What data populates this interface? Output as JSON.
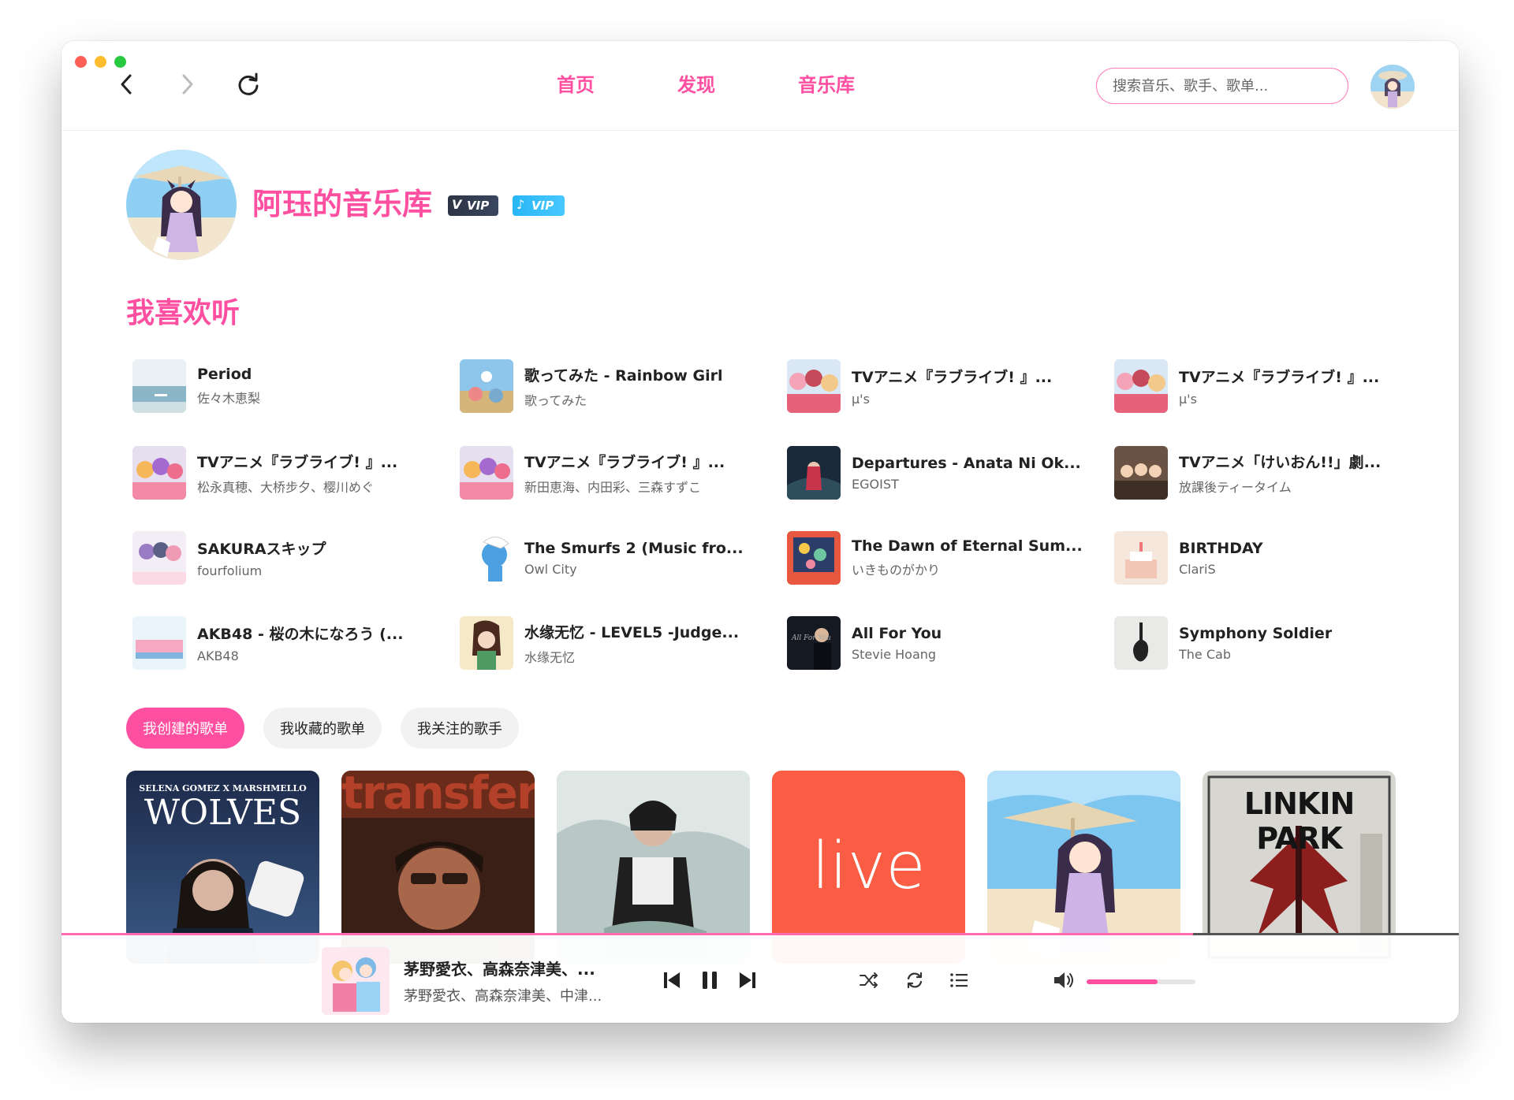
{
  "nav": {
    "links": [
      "首页",
      "发现",
      "音乐库"
    ],
    "search_placeholder": "搜索音乐、歌手、歌单..."
  },
  "profile": {
    "title": "阿珏的音乐库",
    "badges": [
      "VIP",
      "VIP"
    ]
  },
  "liked": {
    "title": "我喜欢听",
    "songs": [
      {
        "title": "Period",
        "artist": "佐々木恵梨"
      },
      {
        "title": "歌ってみた - Rainbow Girl",
        "artist": "歌ってみた"
      },
      {
        "title": "TVアニメ『ラブライブ! 』...",
        "artist": "μ's"
      },
      {
        "title": "TVアニメ『ラブライブ! 』...",
        "artist": "μ's"
      },
      {
        "title": "TVアニメ『ラブライブ! 』...",
        "artist": "松永真穂、大桥步夕、樱川めぐ"
      },
      {
        "title": "TVアニメ『ラブライブ! 』...",
        "artist": "新田恵海、内田彩、三森すずこ"
      },
      {
        "title": "Departures - Anata Ni Ok...",
        "artist": "EGOIST"
      },
      {
        "title": "TVアニメ「けいおん!!」劇...",
        "artist": "放課後ティータイム"
      },
      {
        "title": "SAKURAスキップ",
        "artist": "fourfolium"
      },
      {
        "title": "The Smurfs 2 (Music fro...",
        "artist": "Owl City"
      },
      {
        "title": "The Dawn of Eternal Sum...",
        "artist": "いきものがかり"
      },
      {
        "title": "BIRTHDAY",
        "artist": "ClariS"
      },
      {
        "title": "AKB48 - 桜の木になろう (...",
        "artist": "AKB48"
      },
      {
        "title": "水缘无忆 - LEVEL5 -Judge...",
        "artist": "水缘无忆"
      },
      {
        "title": "All For You",
        "artist": "Stevie Hoang"
      },
      {
        "title": "Symphony Soldier",
        "artist": "The Cab"
      }
    ]
  },
  "tabs": [
    "我创建的歌单",
    "我收藏的歌单",
    "我关注的歌手"
  ],
  "cards": {
    "wolves_top": "SELENA GOMEZ X MARSHMELLO",
    "wolves_title": "WOLVES",
    "transfer": "transfer",
    "live": "live",
    "linkin": "LINKIN PARK"
  },
  "player": {
    "title": "茅野愛衣、高森奈津美、...",
    "artist": "茅野愛衣、高森奈津美、中津...",
    "progress": 0.81,
    "volume": 0.65
  },
  "colors": {
    "accent": "#ff4fa0",
    "vip_dark": "#2c3444",
    "vip_blue": "#28b6f6"
  }
}
